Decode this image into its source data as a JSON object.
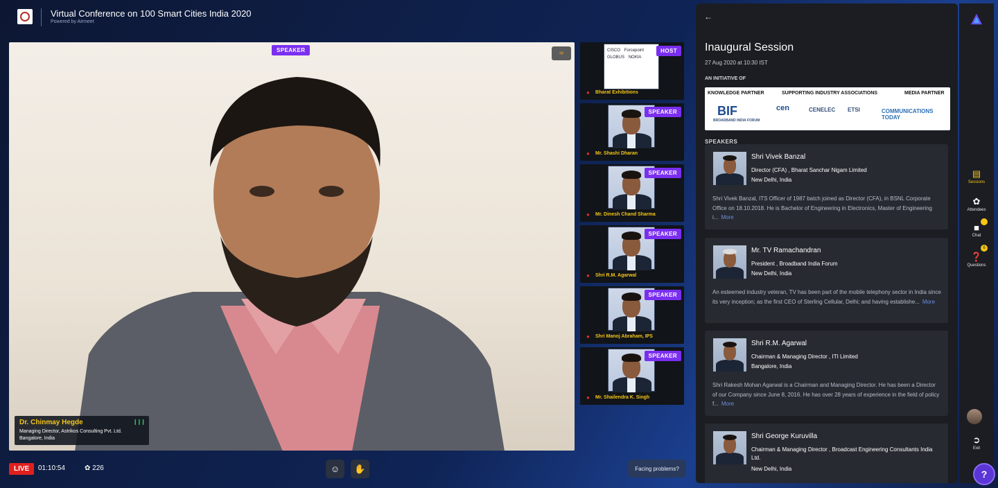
{
  "header": {
    "title": "Virtual Conference on 100 Smart Cities India 2020",
    "powered_by": "Powered by Airmeet"
  },
  "main_stage": {
    "badge": "SPEAKER",
    "presenter": {
      "name": "Dr. Chinmay Hegde",
      "designation": "Managing Director, Astrikos Consulting Pvt. Ltd.",
      "location": "Bangalore, India"
    }
  },
  "tiles": [
    {
      "badge": "HOST",
      "name": "Bharat Exhibitions",
      "logos": [
        "CISCO",
        "Forcepoint",
        "GLOBUS",
        "NOKIA"
      ]
    },
    {
      "badge": "SPEAKER",
      "name": "Mr. Shashi Dharan"
    },
    {
      "badge": "SPEAKER",
      "name": "Mr. Dinesh Chand Sharma"
    },
    {
      "badge": "SPEAKER",
      "name": "Shri R.M. Agarwal"
    },
    {
      "badge": "SPEAKER",
      "name": "Shri Manoj Abraham, IPS"
    },
    {
      "badge": "SPEAKER",
      "name": "Mr. Shailendra K. Singh"
    }
  ],
  "bottom_bar": {
    "live": "LIVE",
    "timer": "01:10:54",
    "viewers": "226",
    "facing_problems": "Facing problems?"
  },
  "panel": {
    "title": "Inaugural Session",
    "date": "27 Aug 2020 at 10:30 IST",
    "initiative": "AN INITIATIVE OF",
    "partners": {
      "knowledge": "KNOWLEDGE PARTNER",
      "industry": "SUPPORTING INDUSTRY ASSOCIATIONS",
      "media": "MEDIA PARTNER",
      "bif": "BIF",
      "bif_sub": "BROADBAND INDIA FORUM",
      "cen": "cen",
      "cenelec": "CENELEC",
      "etsi": "ETSI",
      "comm": "COMMUNICATIONS TODAY"
    },
    "speakers_label": "SPEAKERS",
    "speakers": [
      {
        "name": "Shri Vivek Banzal",
        "role": "Director (CFA) , Bharat Sanchar Nigam Limited",
        "location": "New Delhi, India",
        "bio": "Shri Vivek Banzal, ITS Officer of 1987 batch joined as Director (CFA), in BSNL Corporate Office on 18.10.2018. He is Bachelor of Engineering in Electronics, Master of Engineering i...",
        "more": "More"
      },
      {
        "name": "Mr. TV Ramachandran",
        "role": "President , Broadband India Forum",
        "location": "New Delhi, India",
        "bio": "An esteemed industry veteran, TV has been part of the mobile telephony sector in India since its very inception; as the first CEO of Sterling Cellular, Delhi; and having establishe...",
        "more": "More"
      },
      {
        "name": "Shri R.M. Agarwal",
        "role": "Chairman & Managing Director , ITI Limited",
        "location": "Bangalore, India",
        "bio": "Shri Rakesh Mohan Agarwal is a Chairman and Managing Director. He has been a Director of our Company since June 8, 2016. He has over 28 years of experience in the field of policy f...",
        "more": "More"
      },
      {
        "name": "Shri George Kuruvilla",
        "role": "Chairman & Managing Director , Broadcast Engineering Consultants India Ltd.",
        "location": "New Delhi, India",
        "bio": "",
        "more": ""
      }
    ]
  },
  "rail": {
    "sessions": "Sessions",
    "attendees": "Attendees",
    "chat": "Chat",
    "questions": "Questions",
    "questions_count": "6",
    "exit": "Exit",
    "help": "?"
  },
  "colors": {
    "accent_purple": "#7a2ff0",
    "live_red": "#e0201e",
    "highlight_yellow": "#f5c518"
  }
}
